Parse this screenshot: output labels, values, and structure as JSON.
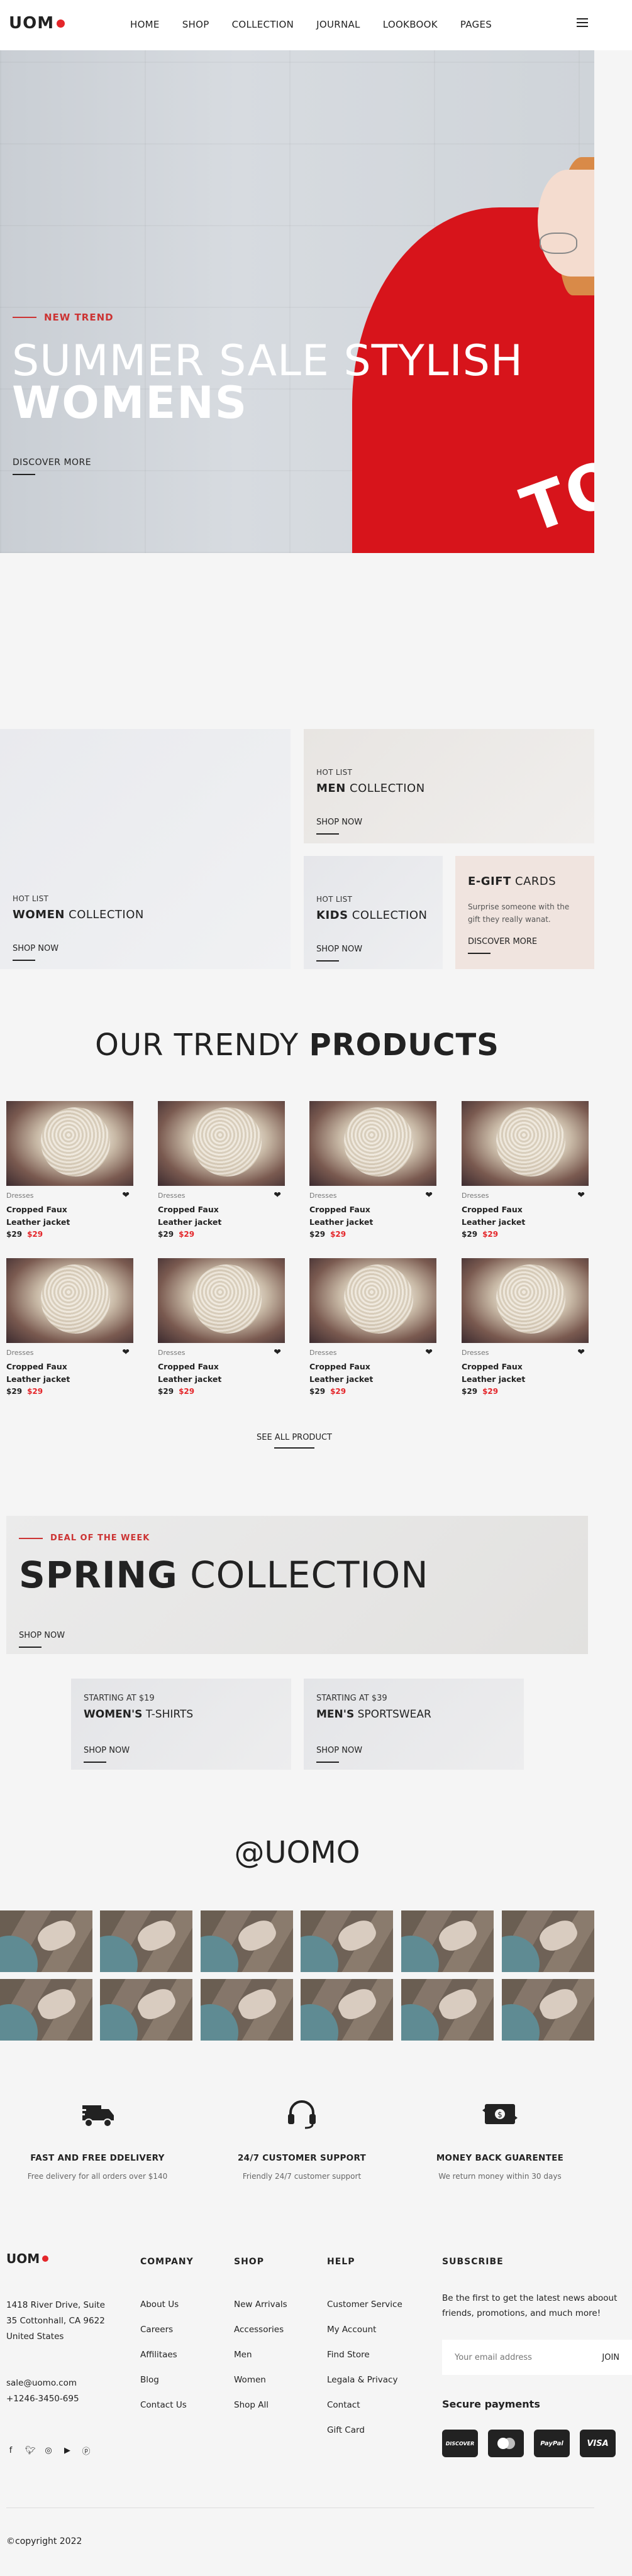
{
  "header": {
    "logo": "UOM",
    "nav": [
      "HOME",
      "SHOP",
      "COLLECTION",
      "JOURNAL",
      "LOOKBOOK",
      "PAGES"
    ]
  },
  "hero": {
    "tag": "NEW TREND",
    "title_light": "SUMMER SALE STYLISH",
    "title_bold": "WOMENS",
    "cta": "DISCOVER MORE",
    "shirt_text": "TO"
  },
  "collections": {
    "women": {
      "small": "HOT LIST",
      "bold": "WOMEN",
      "rest": "COLLECTION",
      "shop": "SHOP NOW"
    },
    "men": {
      "small": "HOT LIST",
      "bold": "MEN",
      "rest": "COLLECTION",
      "shop": "SHOP NOW"
    },
    "kids": {
      "small": "HOT LIST",
      "bold": "KIDS",
      "rest": "COLLECTION",
      "shop": "SHOP NOW"
    },
    "egift": {
      "bold": "E-GIFT",
      "rest": "CARDS",
      "desc": "Surprise someone with the gift they really wanat.",
      "shop": "DISCOVER MORE"
    }
  },
  "trendy": {
    "title_light": "OUR TRENDY",
    "title_bold": "PRODUCTS",
    "products": [
      {
        "category": "Dresses",
        "name": "Cropped Faux Leather jacket",
        "old_price": "$29",
        "new_price": "$29"
      },
      {
        "category": "Dresses",
        "name": "Cropped Faux Leather jacket",
        "old_price": "$29",
        "new_price": "$29"
      },
      {
        "category": "Dresses",
        "name": "Cropped Faux Leather jacket",
        "old_price": "$29",
        "new_price": "$29"
      },
      {
        "category": "Dresses",
        "name": "Cropped Faux Leather jacket",
        "old_price": "$29",
        "new_price": "$29"
      },
      {
        "category": "Dresses",
        "name": "Cropped Faux Leather jacket",
        "old_price": "$29",
        "new_price": "$29"
      },
      {
        "category": "Dresses",
        "name": "Cropped Faux Leather jacket",
        "old_price": "$29",
        "new_price": "$29"
      },
      {
        "category": "Dresses",
        "name": "Cropped Faux Leather jacket",
        "old_price": "$29",
        "new_price": "$29"
      },
      {
        "category": "Dresses",
        "name": "Cropped Faux Leather jacket",
        "old_price": "$29",
        "new_price": "$29"
      }
    ],
    "see_all": "SEE ALL PRODUCT"
  },
  "deal": {
    "tag": "DEAL OF THE WEEK",
    "title_bold": "SPRING",
    "title_light": "COLLECTION",
    "shop": "SHOP NOW",
    "tshirts": {
      "label": "STARTING AT $19",
      "bold": "WOMEN'S",
      "rest": "T-SHIRTS",
      "shop": "SHOP NOW"
    },
    "sportswear": {
      "label": "STARTING AT $39",
      "bold": "MEN'S",
      "rest": "SPORTSWEAR",
      "shop": "SHOP NOW"
    }
  },
  "instagram": {
    "title": "@UOMO"
  },
  "features": [
    {
      "icon": "delivery-truck-icon",
      "title": "FAST AND FREE DDELIVERY",
      "desc": "Free delivery for all orders over $140"
    },
    {
      "icon": "headset-icon",
      "title": "24/7 CUSTOMER SUPPORT",
      "desc": "Friendly 24/7 customer support"
    },
    {
      "icon": "money-exchange-icon",
      "title": "MONEY BACK GUARENTEE",
      "desc": "We return money within 30 days"
    }
  ],
  "footer": {
    "logo": "UOM",
    "address": "1418 River Drive, Suite 35 Cottonhall, CA 9622 United States",
    "email": "sale@uomo.com",
    "phone": "+1246-3450-695",
    "social": [
      "facebook-icon",
      "twitter-icon",
      "instagram-icon",
      "youtube-icon",
      "pinterest-icon"
    ],
    "company": {
      "heading": "COMPANY",
      "items": [
        "About Us",
        "Careers",
        "Affilitaes",
        "Blog",
        "Contact Us"
      ]
    },
    "shop": {
      "heading": "SHOP",
      "items": [
        "New Arrivals",
        "Accessories",
        "Men",
        "Women",
        "Shop All"
      ]
    },
    "help": {
      "heading": "HELP",
      "items": [
        "Customer Service",
        "My Account",
        "Find Store",
        "Legala & Privacy",
        "Contact",
        "Gift Card"
      ]
    },
    "subscribe": {
      "heading": "SUBSCRIBE",
      "text": "Be the first to get the latest news aboout friends, promotions, and much more!",
      "placeholder": "Your email address",
      "join": "JOIN"
    },
    "secure": "Secure payments",
    "payments": [
      "DISCOVER",
      "MasterCard",
      "PayPal",
      "VISA"
    ],
    "copyright": "©copyright 2022"
  }
}
